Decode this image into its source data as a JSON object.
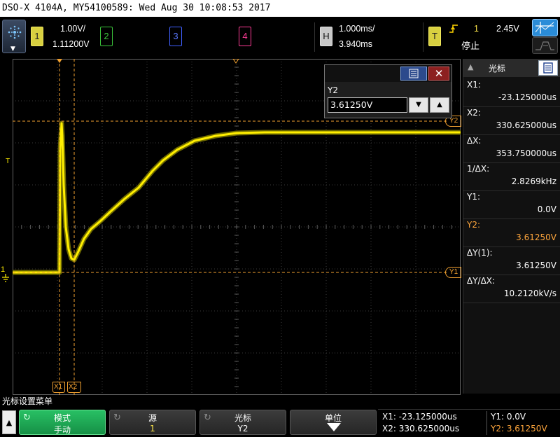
{
  "title": "DSO-X 4104A, MY54100589: Wed Aug 30 10:08:53 2017",
  "channels": [
    {
      "key": "1",
      "scale": "1.00V/",
      "offset": "1.11200V",
      "color": "#d8d040"
    },
    {
      "key": "2",
      "color": "#3cc83c"
    },
    {
      "key": "3",
      "color": "#4060ff"
    },
    {
      "key": "4",
      "color": "#ff3c96"
    }
  ],
  "horizontal": {
    "key": "H",
    "scale": "1.000ms/",
    "delay": "3.940ms"
  },
  "trigger": {
    "key": "T",
    "source": "1",
    "level": "2.45V",
    "status": "停止",
    "slope_icon": "rising-edge-icon"
  },
  "markers": {
    "x1": "X1",
    "x2": "X2",
    "y1": "Y1",
    "y2": "Y2",
    "ch1": "1",
    "trig_level": "T"
  },
  "popup": {
    "label": "Y2",
    "value": "3.61250V"
  },
  "cursor_panel": {
    "title": "光标",
    "rows": [
      {
        "label": "X1:",
        "value": "-23.125000us",
        "color": "#ffffff"
      },
      {
        "label": "X2:",
        "value": "330.625000us",
        "color": "#ffffff"
      },
      {
        "label": "ΔX:",
        "value": "353.750000us",
        "color": "#ffffff"
      },
      {
        "label": "1/ΔX:",
        "value": "2.8269kHz",
        "color": "#ffffff"
      },
      {
        "label": "Y1:",
        "value": "0.0V",
        "color": "#ffffff"
      },
      {
        "label": "Y2:",
        "value": "3.61250V",
        "color": "#ffa63c"
      },
      {
        "label": "ΔY(1):",
        "value": "3.61250V",
        "color": "#ffffff"
      },
      {
        "label": "ΔY/ΔX:",
        "value": "10.2120kV/s",
        "color": "#ffffff"
      }
    ]
  },
  "menu": {
    "title": "光标设置菜单",
    "softkeys": [
      {
        "label": "模式",
        "value": "手动",
        "active": true
      },
      {
        "label": "源",
        "value": "1",
        "active": false
      },
      {
        "label": "光标",
        "value": "Y2",
        "active": false
      },
      {
        "label": "单位",
        "value": "",
        "active": false
      }
    ]
  },
  "status": {
    "x1": "X1: -23.125000us",
    "x2": "X2: 330.625000us",
    "y1": "Y1: 0.0V",
    "y2": "Y2: 3.61250V"
  },
  "colors": {
    "trace": "#e8e000",
    "cursor": "#f0a030",
    "grid": "#3a3a3a"
  }
}
